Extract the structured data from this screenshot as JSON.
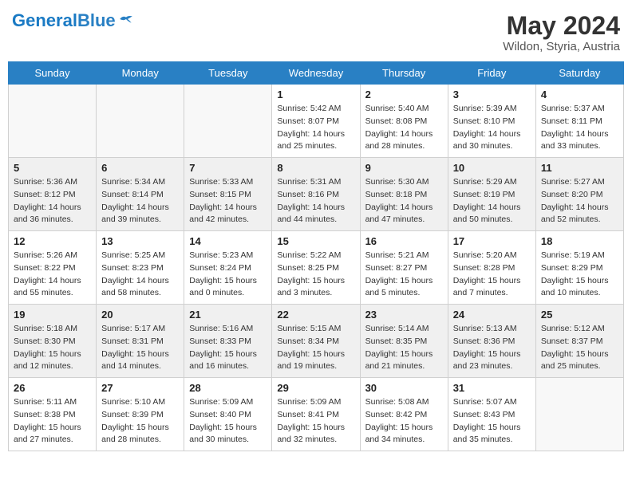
{
  "header": {
    "logo_general": "General",
    "logo_blue": "Blue",
    "month_year": "May 2024",
    "location": "Wildon, Styria, Austria"
  },
  "weekdays": [
    "Sunday",
    "Monday",
    "Tuesday",
    "Wednesday",
    "Thursday",
    "Friday",
    "Saturday"
  ],
  "weeks": [
    [
      {
        "day": "",
        "info": ""
      },
      {
        "day": "",
        "info": ""
      },
      {
        "day": "",
        "info": ""
      },
      {
        "day": "1",
        "info": "Sunrise: 5:42 AM\nSunset: 8:07 PM\nDaylight: 14 hours\nand 25 minutes."
      },
      {
        "day": "2",
        "info": "Sunrise: 5:40 AM\nSunset: 8:08 PM\nDaylight: 14 hours\nand 28 minutes."
      },
      {
        "day": "3",
        "info": "Sunrise: 5:39 AM\nSunset: 8:10 PM\nDaylight: 14 hours\nand 30 minutes."
      },
      {
        "day": "4",
        "info": "Sunrise: 5:37 AM\nSunset: 8:11 PM\nDaylight: 14 hours\nand 33 minutes."
      }
    ],
    [
      {
        "day": "5",
        "info": "Sunrise: 5:36 AM\nSunset: 8:12 PM\nDaylight: 14 hours\nand 36 minutes."
      },
      {
        "day": "6",
        "info": "Sunrise: 5:34 AM\nSunset: 8:14 PM\nDaylight: 14 hours\nand 39 minutes."
      },
      {
        "day": "7",
        "info": "Sunrise: 5:33 AM\nSunset: 8:15 PM\nDaylight: 14 hours\nand 42 minutes."
      },
      {
        "day": "8",
        "info": "Sunrise: 5:31 AM\nSunset: 8:16 PM\nDaylight: 14 hours\nand 44 minutes."
      },
      {
        "day": "9",
        "info": "Sunrise: 5:30 AM\nSunset: 8:18 PM\nDaylight: 14 hours\nand 47 minutes."
      },
      {
        "day": "10",
        "info": "Sunrise: 5:29 AM\nSunset: 8:19 PM\nDaylight: 14 hours\nand 50 minutes."
      },
      {
        "day": "11",
        "info": "Sunrise: 5:27 AM\nSunset: 8:20 PM\nDaylight: 14 hours\nand 52 minutes."
      }
    ],
    [
      {
        "day": "12",
        "info": "Sunrise: 5:26 AM\nSunset: 8:22 PM\nDaylight: 14 hours\nand 55 minutes."
      },
      {
        "day": "13",
        "info": "Sunrise: 5:25 AM\nSunset: 8:23 PM\nDaylight: 14 hours\nand 58 minutes."
      },
      {
        "day": "14",
        "info": "Sunrise: 5:23 AM\nSunset: 8:24 PM\nDaylight: 15 hours\nand 0 minutes."
      },
      {
        "day": "15",
        "info": "Sunrise: 5:22 AM\nSunset: 8:25 PM\nDaylight: 15 hours\nand 3 minutes."
      },
      {
        "day": "16",
        "info": "Sunrise: 5:21 AM\nSunset: 8:27 PM\nDaylight: 15 hours\nand 5 minutes."
      },
      {
        "day": "17",
        "info": "Sunrise: 5:20 AM\nSunset: 8:28 PM\nDaylight: 15 hours\nand 7 minutes."
      },
      {
        "day": "18",
        "info": "Sunrise: 5:19 AM\nSunset: 8:29 PM\nDaylight: 15 hours\nand 10 minutes."
      }
    ],
    [
      {
        "day": "19",
        "info": "Sunrise: 5:18 AM\nSunset: 8:30 PM\nDaylight: 15 hours\nand 12 minutes."
      },
      {
        "day": "20",
        "info": "Sunrise: 5:17 AM\nSunset: 8:31 PM\nDaylight: 15 hours\nand 14 minutes."
      },
      {
        "day": "21",
        "info": "Sunrise: 5:16 AM\nSunset: 8:33 PM\nDaylight: 15 hours\nand 16 minutes."
      },
      {
        "day": "22",
        "info": "Sunrise: 5:15 AM\nSunset: 8:34 PM\nDaylight: 15 hours\nand 19 minutes."
      },
      {
        "day": "23",
        "info": "Sunrise: 5:14 AM\nSunset: 8:35 PM\nDaylight: 15 hours\nand 21 minutes."
      },
      {
        "day": "24",
        "info": "Sunrise: 5:13 AM\nSunset: 8:36 PM\nDaylight: 15 hours\nand 23 minutes."
      },
      {
        "day": "25",
        "info": "Sunrise: 5:12 AM\nSunset: 8:37 PM\nDaylight: 15 hours\nand 25 minutes."
      }
    ],
    [
      {
        "day": "26",
        "info": "Sunrise: 5:11 AM\nSunset: 8:38 PM\nDaylight: 15 hours\nand 27 minutes."
      },
      {
        "day": "27",
        "info": "Sunrise: 5:10 AM\nSunset: 8:39 PM\nDaylight: 15 hours\nand 28 minutes."
      },
      {
        "day": "28",
        "info": "Sunrise: 5:09 AM\nSunset: 8:40 PM\nDaylight: 15 hours\nand 30 minutes."
      },
      {
        "day": "29",
        "info": "Sunrise: 5:09 AM\nSunset: 8:41 PM\nDaylight: 15 hours\nand 32 minutes."
      },
      {
        "day": "30",
        "info": "Sunrise: 5:08 AM\nSunset: 8:42 PM\nDaylight: 15 hours\nand 34 minutes."
      },
      {
        "day": "31",
        "info": "Sunrise: 5:07 AM\nSunset: 8:43 PM\nDaylight: 15 hours\nand 35 minutes."
      },
      {
        "day": "",
        "info": ""
      }
    ]
  ]
}
